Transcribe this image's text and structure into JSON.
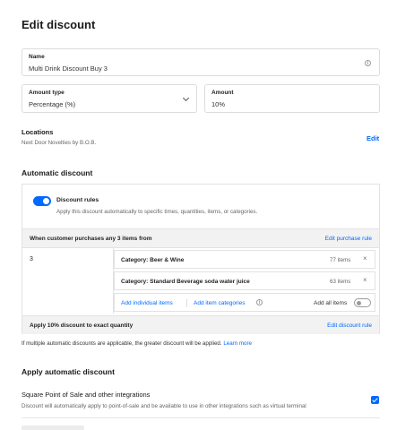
{
  "page": {
    "title": "Edit discount"
  },
  "name_field": {
    "label": "Name",
    "value": "Multi Drink Discount Buy 3"
  },
  "amount_type": {
    "label": "Amount type",
    "value": "Percentage (%)"
  },
  "amount": {
    "label": "Amount",
    "value": "10%"
  },
  "locations": {
    "title": "Locations",
    "value": "Next Door Novelties by B.O.B.",
    "edit_label": "Edit"
  },
  "auto_discount": {
    "title": "Automatic discount",
    "rules_label": "Discount rules",
    "rules_desc": "Apply this discount automatically to specific times, quantities, items, or categories.",
    "purchase_header": "When customer purchases any 3 items from",
    "edit_purchase_rule": "Edit purchase rule",
    "quantity": "3",
    "categories": [
      {
        "name": "Category: Beer & Wine",
        "count": "77 items"
      },
      {
        "name": "Category: Standard Beverage soda water juice",
        "count": "63 items"
      }
    ],
    "add_individual_items": "Add individual items",
    "add_item_categories": "Add item categories",
    "add_all_items": "Add all items",
    "apply_text": "Apply 10% discount to exact quantity",
    "edit_discount_rule": "Edit discount rule",
    "note": "If multiple automatic discounts are applicable, the greater discount will be applied.",
    "learn_more": "Learn more"
  },
  "apply_section": {
    "title": "Apply automatic discount",
    "option_title": "Square Point of Sale and other integrations",
    "option_desc": "Discount will automatically apply to point-of-sale and be available to use in other integrations such as virtual terminal",
    "option_checked": true
  },
  "colors": {
    "accent": "#006aff"
  }
}
